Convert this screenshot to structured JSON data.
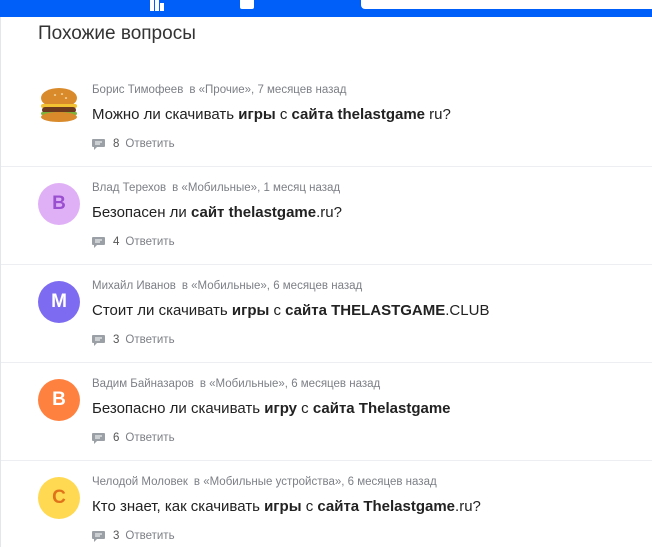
{
  "colors": {
    "topbar": "#005ff9",
    "avatar_v1": "#e0b0f7",
    "avatar_m": "#7d6cf1",
    "avatar_v2": "#ff8140",
    "avatar_s": "#ffd952"
  },
  "section": {
    "title": "Похожие вопросы"
  },
  "questions": [
    {
      "author": "Борис Тимофеев",
      "category": "в «Прочие»",
      "time": "7 месяцев назад",
      "avatar": {
        "type": "image",
        "icon": "burger-icon"
      },
      "title_parts": [
        "Можно ли скачивать ",
        "игры",
        " с ",
        "сайта thelastgame",
        " ru?"
      ],
      "answers": "8",
      "reply_label": "Ответить"
    },
    {
      "author": "Влад Терехов",
      "category": "в «Мобильные»",
      "time": "1 месяц назад",
      "avatar": {
        "letter": "В"
      },
      "title_parts": [
        "Безопасен ли ",
        "сайт thelastgame",
        ".ru?"
      ],
      "answers": "4",
      "reply_label": "Ответить"
    },
    {
      "author": "Михайл Иванов",
      "category": "в «Мобильные»",
      "time": "6 месяцев назад",
      "avatar": {
        "letter": "М"
      },
      "title_parts": [
        "Стоит ли скачивать ",
        "игры",
        " с ",
        "сайта THELASTGAME",
        ".CLUB"
      ],
      "answers": "3",
      "reply_label": "Ответить"
    },
    {
      "author": "Вадим Байназаров",
      "category": "в «Мобильные»",
      "time": "6 месяцев назад",
      "avatar": {
        "letter": "В"
      },
      "title_parts": [
        "Безопасно ли скачивать ",
        "игру",
        " с ",
        "сайта Thelastgame"
      ],
      "answers": "6",
      "reply_label": "Ответить"
    },
    {
      "author": "Челодой Моловек",
      "category": "в «Мобильные устройства»",
      "time": "6 месяцев назад",
      "avatar": {
        "letter": "С"
      },
      "title_parts": [
        "Кто знает, как скачивать ",
        "игры",
        " с ",
        "сайта Thelastgame",
        ".ru?"
      ],
      "answers": "3",
      "reply_label": "Ответить"
    }
  ]
}
